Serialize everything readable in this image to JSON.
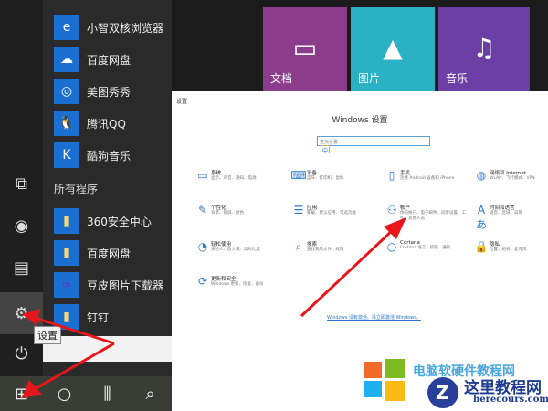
{
  "rail": {
    "items": [
      "tablet-mode",
      "user",
      "documents",
      "settings",
      "power"
    ]
  },
  "apps": {
    "recent": [
      "小智双核浏览器",
      "百度网盘",
      "美图秀秀",
      "腾讯QQ",
      "酷狗音乐"
    ],
    "section": "所有程序",
    "all": [
      "360安全中心",
      "百度网盘",
      "豆皮图片下载器",
      "钉钉"
    ]
  },
  "tiles": [
    "文档",
    "图片",
    "音乐"
  ],
  "tooltip": "设置",
  "settings": {
    "window_title": "设置",
    "heading": "Windows 设置",
    "search_placeholder": "查找设置",
    "ime": "中",
    "categories": [
      {
        "name": "系统",
        "desc": "显示、声音、通知、电源"
      },
      {
        "name": "设备",
        "desc": "蓝牙、打印机、鼠标"
      },
      {
        "name": "手机",
        "desc": "连接 Android 设备和 iPhone"
      },
      {
        "name": "网络和 Internet",
        "desc": "WLAN、飞行模式、VPN"
      },
      {
        "name": "个性化",
        "desc": "背景、锁屏、颜色"
      },
      {
        "name": "应用",
        "desc": "卸载、默认应用、可选功能"
      },
      {
        "name": "帐户",
        "desc": "你的帐户、电子邮件、同步设置、工作、其他人员"
      },
      {
        "name": "时间和语言",
        "desc": "语音、区域、日期"
      },
      {
        "name": "轻松使用",
        "desc": "讲述人、放大镜、高对比度"
      },
      {
        "name": "搜索",
        "desc": "查找我的文件、权限"
      },
      {
        "name": "Cortana",
        "desc": "Cortana 语言、权限、通知"
      },
      {
        "name": "隐私",
        "desc": "位置、相机、麦克风"
      },
      {
        "name": "更新和安全",
        "desc": "Windows 更新、恢复、备份"
      }
    ],
    "activation": "Windows 没有激活。请立即激活 Windows。"
  },
  "watermark": {
    "title": "电脑软硬件教程网",
    "brand": "这里教程网",
    "url": "herecours.com"
  },
  "colors": {
    "arrow": "#e8161b",
    "tile_purple": "#8b3d8c",
    "tile_teal": "#2bb1c4",
    "tile_violet": "#6b3fa5",
    "accent": "#2a76c6"
  }
}
